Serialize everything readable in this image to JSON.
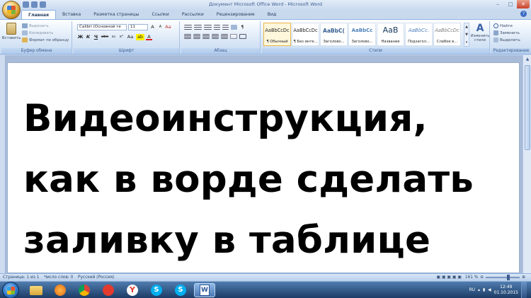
{
  "window": {
    "title": "Документ Microsoft Office Word - Microsoft Word",
    "controls": {
      "minimize": "–",
      "maximize": "□",
      "close": "✕"
    }
  },
  "tabs": [
    {
      "label": "Главная",
      "active": true
    },
    {
      "label": "Вставка"
    },
    {
      "label": "Разметка страницы"
    },
    {
      "label": "Ссылки"
    },
    {
      "label": "Рассылки"
    },
    {
      "label": "Рецензирование"
    },
    {
      "label": "Вид"
    }
  ],
  "ribbon": {
    "clipboard": {
      "label": "Буфер обмена",
      "paste": "Вставить",
      "cut": "Вырезать",
      "copy": "Копировать",
      "format_painter": "Формат по образцу"
    },
    "font": {
      "label": "Шрифт",
      "font_name": "Calibri (Основной те",
      "font_size": "11",
      "grow": "A",
      "shrink": "A",
      "clear": "Aa",
      "bold": "Ж",
      "italic": "К",
      "underline": "Ч",
      "strike": "abe",
      "subscript": "x₂",
      "superscript": "x²",
      "change_case": "Aa",
      "highlight": "ab",
      "font_color": "A"
    },
    "paragraph": {
      "label": "Абзац",
      "pilcrow": "¶"
    },
    "styles": {
      "label": "Стили",
      "items": [
        {
          "sample": "AaBbCcDc",
          "name": "¶ Обычный",
          "selected": true
        },
        {
          "sample": "AaBbCcDc",
          "name": "¶ Без инте..."
        },
        {
          "sample": "AaBbC(",
          "name": "Заголово..."
        },
        {
          "sample": "AaBbCc",
          "name": "Заголово..."
        },
        {
          "sample": "AaB",
          "name": "Название"
        },
        {
          "sample": "AaBbCc.",
          "name": "Подзагол..."
        },
        {
          "sample": "AaBbCcDc",
          "name": "Слабое в..."
        }
      ],
      "change_styles": "Изменить стили"
    },
    "editing": {
      "label": "Редактирование",
      "find": "Найти",
      "replace": "Заменить",
      "select": "Выделить"
    }
  },
  "document": {
    "lines": [
      "Видеоинструкция,",
      "как в ворде сделать",
      "заливку в таблице"
    ]
  },
  "status": {
    "page": "Страница: 1 из 1",
    "words": "Число слов: 0",
    "language": "Русский (Россия)",
    "zoom": "161 %",
    "zoom_percent": 161
  },
  "taskbar": {
    "language": "RU",
    "time": "12:49",
    "date": "01.10.2015",
    "apps": [
      "explorer-icon",
      "media-player-icon",
      "chrome-icon",
      "yandex-icon",
      "skype-icon",
      "skype-icon",
      "word-icon"
    ]
  }
}
